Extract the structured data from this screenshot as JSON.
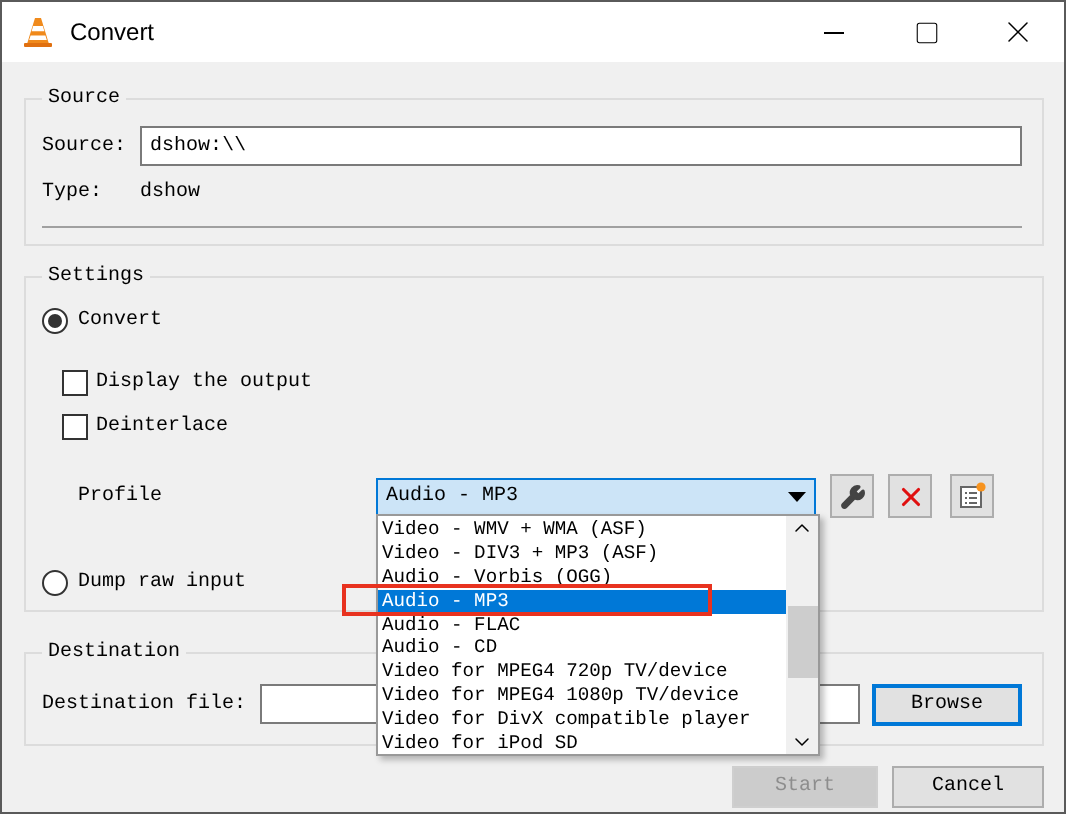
{
  "window": {
    "title": "Convert"
  },
  "source": {
    "title": "Source",
    "source_label": "Source:",
    "source_value": "dshow:\\\\",
    "type_label": "Type:",
    "type_value": "dshow"
  },
  "settings": {
    "title": "Settings",
    "modes": [
      {
        "label": "Convert",
        "selected": true
      },
      {
        "label": "Dump raw input",
        "selected": false
      }
    ],
    "options": [
      {
        "label": "Display the output",
        "checked": false
      },
      {
        "label": "Deinterlace",
        "checked": false
      }
    ],
    "profile_label": "Profile",
    "profile_value": "Audio - MP3",
    "profile_list": [
      {
        "label": "Video - WMV + WMA (ASF)",
        "selected": false,
        "highlighted": false
      },
      {
        "label": "Video - DIV3 + MP3 (ASF)",
        "selected": false,
        "highlighted": false
      },
      {
        "label": "Audio - Vorbis (OGG)",
        "selected": false,
        "highlighted": false
      },
      {
        "label": "Audio - MP3",
        "selected": true,
        "highlighted": true
      },
      {
        "label": "Audio - FLAC",
        "selected": false,
        "highlighted": false
      },
      {
        "label": "Audio - CD",
        "selected": false,
        "highlighted": false
      },
      {
        "label": "Video for MPEG4 720p TV/device",
        "selected": false,
        "highlighted": false
      },
      {
        "label": "Video for MPEG4 1080p TV/device",
        "selected": false,
        "highlighted": false
      },
      {
        "label": "Video for DivX compatible player",
        "selected": false,
        "highlighted": false
      },
      {
        "label": "Video for iPod SD",
        "selected": false,
        "highlighted": false
      }
    ]
  },
  "destination": {
    "title": "Destination",
    "file_label": "Destination file:",
    "browse": "Browse"
  },
  "buttons": [
    {
      "label": "Start",
      "disabled": true
    },
    {
      "label": "Cancel",
      "disabled": false
    }
  ]
}
